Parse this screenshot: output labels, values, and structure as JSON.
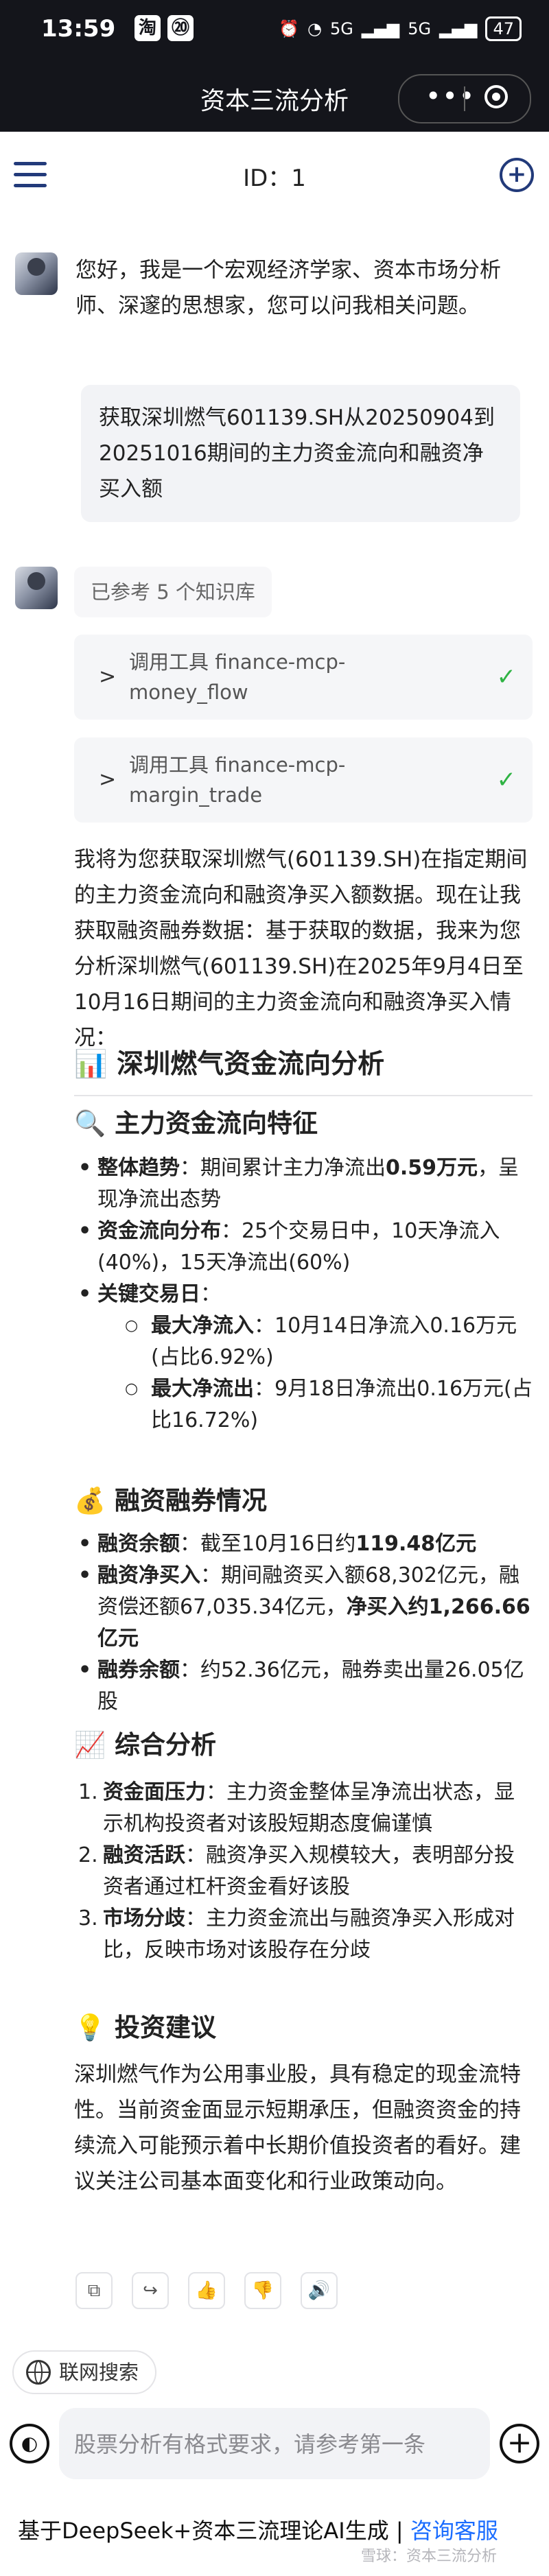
{
  "status_bar": {
    "time": "13:59",
    "app_icon_1": "淘",
    "app_icon_2": "⑳",
    "signal_1": "5G",
    "signal_2": "5G",
    "battery": "47"
  },
  "title_bar": {
    "title": "资本三流分析",
    "more_label": "•••"
  },
  "header": {
    "id_label": "ID：1"
  },
  "chat": {
    "greeting": "您好，我是一个宏观经济学家、资本市场分析师、深邃的思想家，您可以问我相关问题。",
    "user_message": "获取深圳燃气601139.SH从20250904到20251016期间的主力资金流向和融资净买入额",
    "reference_chip": "已参考 5 个知识库",
    "tool_calls": [
      {
        "line1": "调用工具 finance-mcp-",
        "line2": "money_flow"
      },
      {
        "line1": "调用工具 finance-mcp-",
        "line2": "margin_trade"
      }
    ],
    "intro": "我将为您获取深圳燃气(601139.SH)在指定期间的主力资金流向和融资净买入额数据。现在让我获取融资融券数据：基于获取的数据，我来为您分析深圳燃气(601139.SH)在2025年9月4日至10月16日期间的主力资金流向和融资净买入情况：",
    "h2_icon": "📊",
    "h2_title": "深圳燃气资金流向分析",
    "sec1": {
      "icon": "🔍",
      "title": "主力资金流向特征",
      "b1_label": "整体趋势",
      "b1_text1": "：期间累计主力净流出",
      "b1_bold": "0.59万元",
      "b1_text2": "，呈现净流出态势",
      "b2_label": "资金流向分布",
      "b2_text": "：25个交易日中，10天净流入(40%)，15天净流出(60%)",
      "b3_label": "关键交易日",
      "b3_text": "：",
      "s1_label": "最大净流入",
      "s1_text": "：10月14日净流入0.16万元(占比6.92%)",
      "s2_label": "最大净流出",
      "s2_text": "：9月18日净流出0.16万元(占比16.72%)"
    },
    "sec2": {
      "icon": "💰",
      "title": "融资融券情况",
      "b1_label": "融资余额",
      "b1_text": "：截至10月16日约",
      "b1_bold": "119.48亿元",
      "b2_label": "融资净买入",
      "b2_text": "：期间融资买入额68,302亿元，融资偿还额67,035.34亿元，",
      "b2_bold": "净买入约1,266.66亿元",
      "b3_label": "融券余额",
      "b3_text": "：约52.36亿元，融券卖出量26.05亿股"
    },
    "sec3": {
      "icon": "📈",
      "title": "综合分析",
      "items": [
        {
          "num": "1.",
          "label": "资金面压力",
          "text": "：主力资金整体呈净流出状态，显示机构投资者对该股短期态度偏谨慎"
        },
        {
          "num": "2.",
          "label": "融资活跃",
          "text": "：融资净买入规模较大，表明部分投资者通过杠杆资金看好该股"
        },
        {
          "num": "3.",
          "label": "市场分歧",
          "text": "：主力资金流出与融资净买入形成对比，反映市场对该股存在分歧"
        }
      ]
    },
    "sec4": {
      "icon": "💡",
      "title": "投资建议",
      "text": "深圳燃气作为公用事业股，具有稳定的现金流特性。当前资金面显示短期承压，但融资资金的持续流入可能预示着中长期价值投资者的看好。建议关注公司基本面变化和行业政策动向。"
    },
    "actions": [
      "⧉",
      "↪",
      "👍",
      "👎",
      "🔊"
    ]
  },
  "bottom": {
    "web_search_label": "联网搜索",
    "voice_glyph": "◐",
    "input_placeholder": "股票分析有格式要求，请参考第一条",
    "plus_glyph": "+",
    "footer_text": "基于DeepSeek+资本三流理论AI生成 | ",
    "footer_link": "咨询客服",
    "watermark": "雪球：资本三流分析"
  },
  "colors": {
    "top_bar_bg": "#14151b",
    "accent_navy": "#223a7a",
    "link_blue": "#1a6cff",
    "check_green": "#2fb344"
  },
  "icons": [
    "menu-icon",
    "new-chat-icon",
    "more-icon",
    "close-circle-icon",
    "chevron-right-icon",
    "check-icon",
    "copy-icon",
    "share-icon",
    "thumbs-up-icon",
    "thumbs-down-icon",
    "speaker-icon",
    "globe-icon",
    "voice-icon",
    "plus-icon"
  ]
}
